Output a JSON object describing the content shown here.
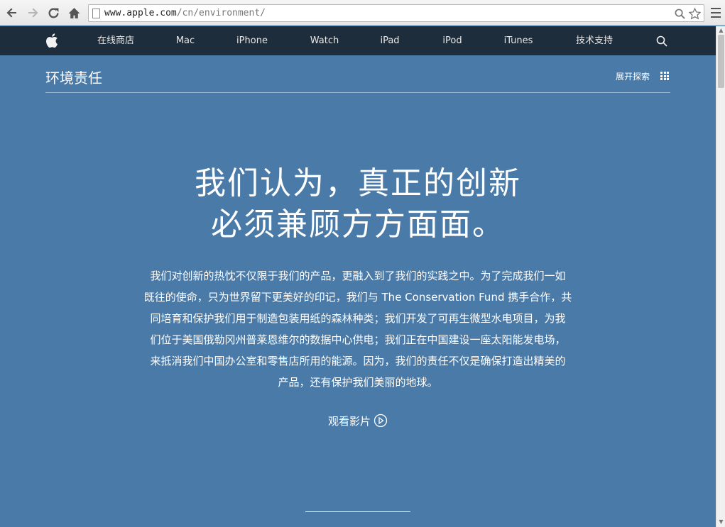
{
  "browser": {
    "url_host": "www.apple.com",
    "url_path": "/cn/environment/",
    "icons": [
      "back-icon",
      "forward-icon",
      "reload-icon",
      "home-icon",
      "zoom-icon",
      "star-icon",
      "menu-icon"
    ]
  },
  "globalnav": {
    "items": [
      "在线商店",
      "Mac",
      "iPhone",
      "Watch",
      "iPad",
      "iPod",
      "iTunes",
      "技术支持"
    ],
    "icons": [
      "apple-logo-icon",
      "search-icon"
    ]
  },
  "localnav": {
    "title": "环境责任",
    "explore_label": "展开探索"
  },
  "hero": {
    "headline_line1": "我们认为，真正的创新",
    "headline_line2": "必须兼顾方方面面。",
    "body_lines": [
      "我们对创新的热忱不仅限于我们的产品，更融入到了我们的实践之中。为了完成我们一如",
      "既往的使命，只为世界留下更美好的印记，我们与 The Conservation Fund 携手合作，共",
      "同培育和保护我们用于制造包装用纸的森林种类；我们开发了可再生微型水电项目，为我",
      "们位于美国俄勒冈州普莱恩维尔的数据中心供电；我们正在中国建设一座太阳能发电场，",
      "来抵消我们中国办公室和零售店所用的能源。因为，我们的责任不仅是确保打造出精美的",
      "产品，还有保护我们美丽的地球。"
    ],
    "watch_label": "观看影片"
  },
  "colors": {
    "background": "#4a7aa8",
    "globalnav": "#1e2d3b"
  }
}
